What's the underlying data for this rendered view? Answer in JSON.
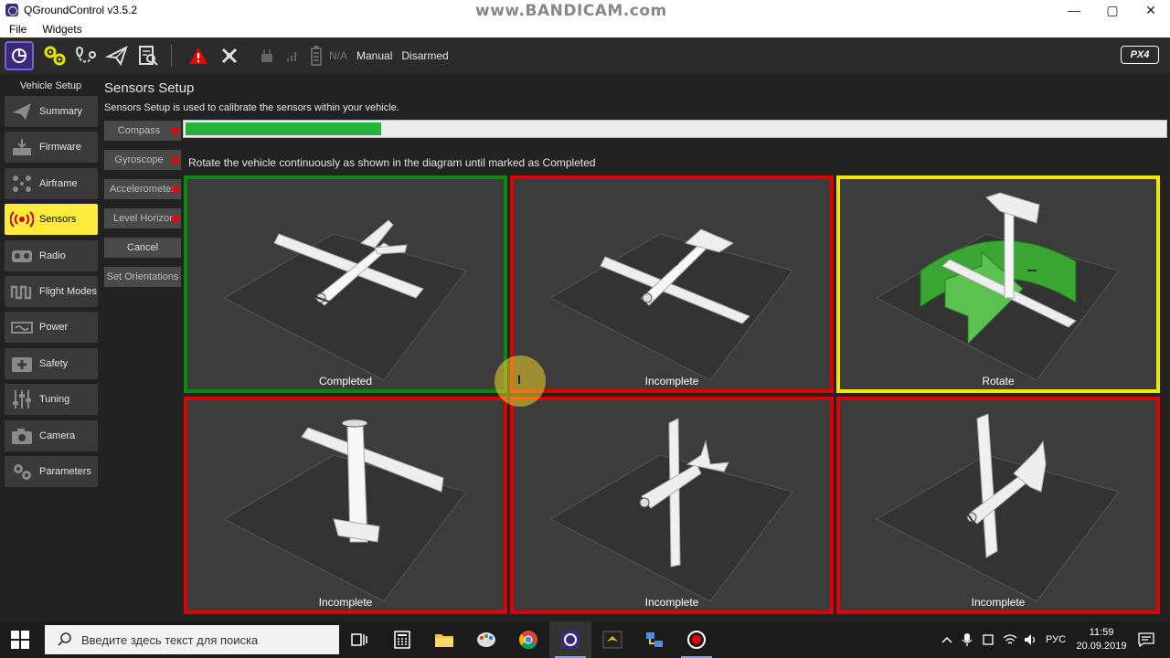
{
  "window": {
    "title": "QGroundControl v3.5.2",
    "watermark": "www.BANDICAM.com",
    "minimize": "—",
    "maximize": "▢",
    "close": "✕"
  },
  "menu": {
    "file": "File",
    "widgets": "Widgets"
  },
  "toolbar": {
    "battery": "N/A",
    "flight_mode": "Manual",
    "arm_state": "Disarmed",
    "brand": "PX4"
  },
  "sidebar": {
    "title": "Vehicle Setup",
    "items": [
      {
        "label": "Summary",
        "icon": "plane-icon"
      },
      {
        "label": "Firmware",
        "icon": "firmware-icon"
      },
      {
        "label": "Airframe",
        "icon": "airframe-icon"
      },
      {
        "label": "Sensors",
        "icon": "sensors-icon"
      },
      {
        "label": "Radio",
        "icon": "radio-icon"
      },
      {
        "label": "Flight Modes",
        "icon": "waveform-icon"
      },
      {
        "label": "Power",
        "icon": "power-icon"
      },
      {
        "label": "Safety",
        "icon": "safety-icon"
      },
      {
        "label": "Tuning",
        "icon": "sliders-icon"
      },
      {
        "label": "Camera",
        "icon": "camera-icon"
      },
      {
        "label": "Parameters",
        "icon": "gears-icon"
      }
    ],
    "active_index": 3
  },
  "main": {
    "title": "Sensors Setup",
    "description": "Sensors Setup is used to calibrate the sensors within your vehicle.",
    "buttons": {
      "compass": "Compass",
      "gyroscope": "Gyroscope",
      "accelerometer": "Accelerometer",
      "level_horizon": "Level Horizon",
      "cancel": "Cancel",
      "set_orientations": "Set Orientations"
    },
    "progress": 0.2,
    "instruction": "Rotate the vehicle continuously as shown in the diagram until marked as Completed",
    "cells": [
      {
        "caption": "Completed",
        "status": "completed",
        "color": "#0a8a0a"
      },
      {
        "caption": "Incomplete",
        "status": "incomplete",
        "color": "#dd0000"
      },
      {
        "caption": "Rotate",
        "status": "active",
        "color": "#f2e600"
      },
      {
        "caption": "Incomplete",
        "status": "incomplete",
        "color": "#dd0000"
      },
      {
        "caption": "Incomplete",
        "status": "incomplete",
        "color": "#dd0000"
      },
      {
        "caption": "Incomplete",
        "status": "incomplete",
        "color": "#dd0000"
      }
    ]
  },
  "taskbar": {
    "search_placeholder": "Введите здесь текст для поиска",
    "language": "РУС",
    "time": "11:59",
    "date": "20.09.2019"
  },
  "colors": {
    "active_item": "#ffeb3b",
    "progress_fill": "#27b33a",
    "completed": "#0a8a0a",
    "incomplete": "#dd0000",
    "rotate": "#f2e600"
  }
}
